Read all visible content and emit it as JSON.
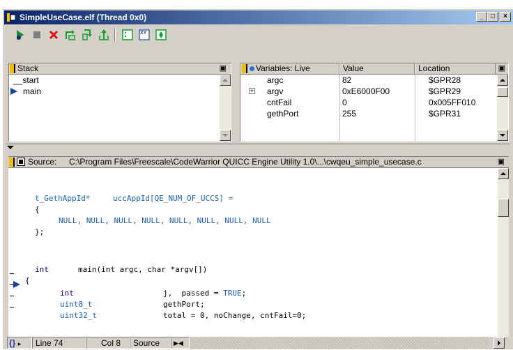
{
  "window": {
    "title": "SimpleUseCase.elf (Thread 0x0)",
    "minimize": "_",
    "maximize": "□",
    "close": "×"
  },
  "toolbar": {
    "buttons": [
      "run-icon",
      "stop-icon",
      "kill-icon",
      "step-over-icon",
      "step-into-icon",
      "step-out-icon",
      "registers-icon",
      "xy-icon",
      "breakpoint-icon"
    ],
    "xy_label": "XY"
  },
  "stack": {
    "header": "Stack",
    "items": [
      "__start",
      "main"
    ],
    "current_index": 1
  },
  "variables": {
    "header": "Variables: Live",
    "columns": [
      "Value",
      "Location"
    ],
    "rows": [
      {
        "name": "argc",
        "value": "82",
        "location": "$GPR28",
        "expandable": false
      },
      {
        "name": "argv",
        "value": "0xE6000F00",
        "location": "$GPR29",
        "expandable": true
      },
      {
        "name": "cntFail",
        "value": "0",
        "location": "0x005FF010",
        "expandable": false
      },
      {
        "name": "gethPort",
        "value": "255",
        "location": "$GPR31",
        "expandable": false
      }
    ],
    "expand_symbol": "+"
  },
  "source": {
    "label": "Source:",
    "path": "C:\\Program Files\\Freescale\\CodeWarrior QUICC Engine Utility 1.0\\...\\cwqeu_simple_usecase.c",
    "lines": {
      "l1a": "t_GethAppId*",
      "l1b": "uccAppId[QE_NUM_OF_UCCS] =",
      "l2": "{",
      "l3": "NULL, NULL, NULL, NULL, NULL, NULL, NULL, NULL",
      "l4": "};",
      "l5a": "int",
      "l5b": "main(int argc, char *argv[])",
      "l6": "{",
      "l7a": "int",
      "l7b": "j,  passed = ",
      "l7c": "TRUE",
      "l7d": ";",
      "l8a": "uint8_t",
      "l8b": "gethPort;",
      "l9a": "uint32_t",
      "l9b": "total = 0, noChange, cntFail=0;"
    }
  },
  "status": {
    "line": "Line 74",
    "col": "Col 8",
    "mode": "Source"
  },
  "colors": {
    "title_start": "#0a246a",
    "title_end": "#a6caf0",
    "chrome": "#d4d0c8",
    "code_blue": "#1a60b0"
  }
}
